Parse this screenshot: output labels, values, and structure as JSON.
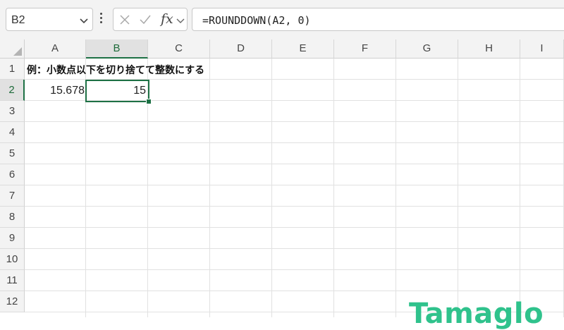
{
  "formula_bar": {
    "name_box_value": "B2",
    "fx_label": "fx",
    "formula": "=ROUNDDOWN(A2, 0)"
  },
  "columns": [
    "A",
    "B",
    "C",
    "D",
    "E",
    "F",
    "G",
    "H",
    "I"
  ],
  "active_column": "B",
  "rows": [
    "1",
    "2",
    "3",
    "4",
    "5",
    "6",
    "7",
    "8",
    "9",
    "10",
    "11",
    "12"
  ],
  "active_row": "2",
  "cells": {
    "A1": "例：小数点以下を切り捨てて整数にする",
    "A2": "15.678",
    "B2": "15"
  },
  "watermark": "Tamaglo",
  "colors": {
    "accent": "#1e7145",
    "logo": "#2fc28c"
  }
}
